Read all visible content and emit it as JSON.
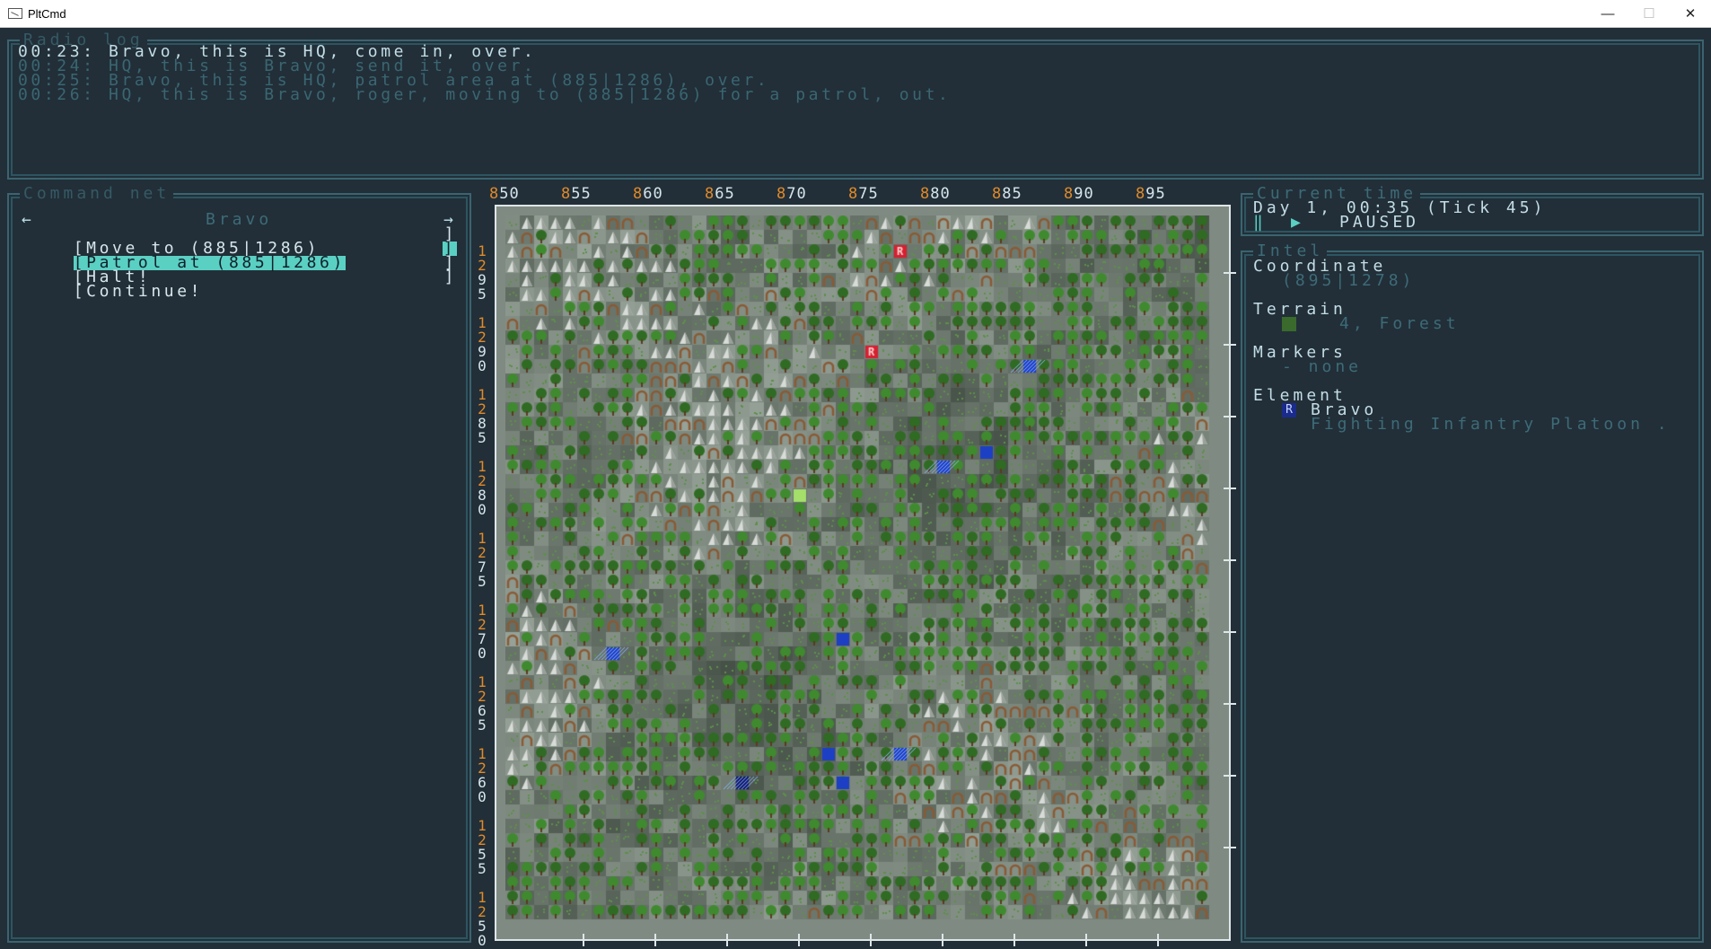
{
  "window": {
    "title": "PltCmd",
    "minimize": "—",
    "maximize": "☐",
    "close": "✕"
  },
  "radio_log": {
    "title": "Radio log",
    "lines": [
      "00:23: Bravo, this is HQ, come in, over.",
      "00:24: HQ, this is Bravo, send it, over.",
      "00:25: Bravo, this is HQ, patrol area at (885|1286), over.",
      "00:26: HQ, this is Bravo, roger, moving to (885|1286) for a patrol, out."
    ]
  },
  "command_net": {
    "title": "Command net",
    "prev_arrow": "←",
    "element": "Bravo",
    "next_arrow": "→",
    "items": [
      {
        "label": "[Move to (885|1286)",
        "right": "]"
      },
      {
        "label": "[Patrol at (885|1286)",
        "right": "]"
      },
      {
        "label": "[Halt!",
        "right": "]"
      },
      {
        "label": "[Continue!",
        "right": "]"
      }
    ],
    "selected_index": 1
  },
  "map": {
    "x_ticks": [
      {
        "h": "8",
        "t": "50"
      },
      {
        "h": "8",
        "t": "55"
      },
      {
        "h": "8",
        "t": "60"
      },
      {
        "h": "8",
        "t": "65"
      },
      {
        "h": "8",
        "t": "70"
      },
      {
        "h": "8",
        "t": "75"
      },
      {
        "h": "8",
        "t": "80"
      },
      {
        "h": "8",
        "t": "85"
      },
      {
        "h": "8",
        "t": "90"
      },
      {
        "h": "8",
        "t": "95"
      }
    ],
    "y_ticks": [
      {
        "a": "1",
        "b": "2",
        "c": "9",
        "d": "5"
      },
      {
        "a": "1",
        "b": "2",
        "c": "9",
        "d": "0"
      },
      {
        "a": "1",
        "b": "2",
        "c": "8",
        "d": "5"
      },
      {
        "a": "1",
        "b": "2",
        "c": "8",
        "d": "0"
      },
      {
        "a": "1",
        "b": "2",
        "c": "7",
        "d": "5"
      },
      {
        "a": "1",
        "b": "2",
        "c": "7",
        "d": "0"
      },
      {
        "a": "1",
        "b": "2",
        "c": "6",
        "d": "5"
      },
      {
        "a": "1",
        "b": "2",
        "c": "6",
        "d": "0"
      },
      {
        "a": "1",
        "b": "2",
        "c": "5",
        "d": "5"
      },
      {
        "a": "1",
        "b": "2",
        "c": "5",
        "d": "0"
      }
    ],
    "unit_letter": "R",
    "colors": {
      "forest": "#2f6b22",
      "forest_light": "#3f8a2e",
      "grass": "#8e9a8e",
      "mountain": "#d8dcd8",
      "hill": "#8a5a34",
      "enemy": "#d62030",
      "friendly": "#1c3fc4",
      "friendly_dark": "#0f1a6a",
      "cursor": "#a4e06a"
    }
  },
  "current_time": {
    "title": "Current time",
    "line": "Day 1, 00:35 (Tick 45)",
    "pause_icon": "‖",
    "play_icon": "▶",
    "status": "PAUSED"
  },
  "intel": {
    "title": "Intel",
    "coordinate_label": "Coordinate",
    "coordinate_value": "(895|1278)",
    "terrain_label": "Terrain",
    "terrain_value": "4, Forest",
    "markers_label": "Markers",
    "markers_value": "- none",
    "element_label": "Element",
    "element_badge": "R",
    "element_name": "Bravo",
    "element_type": "Fighting Infantry Platoon ."
  }
}
